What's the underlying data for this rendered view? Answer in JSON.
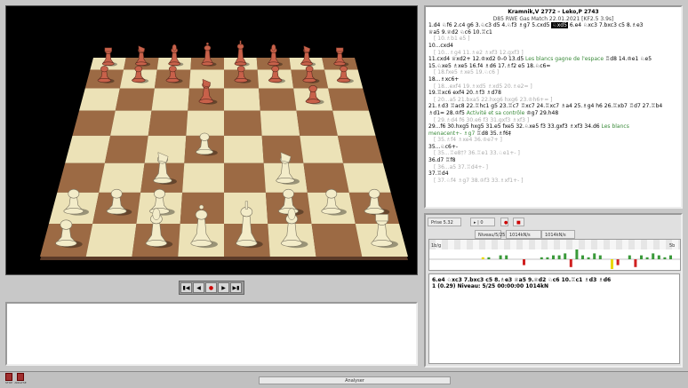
{
  "board": {
    "files": 8,
    "ranks": 8
  },
  "nav": {
    "buttons": [
      {
        "name": "first-move",
        "glyph": "▮◀"
      },
      {
        "name": "prev-move",
        "glyph": "◀"
      },
      {
        "name": "play",
        "glyph": "●"
      },
      {
        "name": "next-move",
        "glyph": "▶"
      },
      {
        "name": "last-move",
        "glyph": "▶▮"
      }
    ]
  },
  "notation": {
    "header": "Kramnik,V 2772 – Leko,P 2743",
    "subheader": "D85 RWE Gas Match 22.01.2021 [KF2.5 3.9s]",
    "lines": [
      {
        "t": "1.d4 ♘f6 2.c4 g6 3.♘c3 d5 4.♘f3 ♗g7 5.cxd5 ",
        "cur": "♘xd5",
        "after": " 6.e4 ♘xc3 7.bxc3 c5 8.♗e3"
      },
      {
        "t": "♕a5 9.♕d2 ♘c6 10.♖c1"
      },
      {
        "t": "[ 10.♗b1 e5 ]",
        "v": true
      },
      {
        "t": "10...cxd4"
      },
      {
        "t": "[ 10...♗g4 11.♗e2 ♗xf3 12.gxf3 ]",
        "v": true
      },
      {
        "t": "11.cxd4 ♕xd2+ 12.♔xd2 0–0 13.d5 ",
        "g": "Les blancs gagne de l'espace",
        "after": " ♖d8 14.♔e1 ♘e5"
      },
      {
        "t": "15.♘xe5 ♗xe5 16.f4 ♗d6 17.♗f2 e5 18.♘c6="
      },
      {
        "t": "[ 18.fxe5 ♗xe5 19.♘c6 ]",
        "v": true
      },
      {
        "t": "18...♗xc6+"
      },
      {
        "t": "[ 18...exf4 19.♗xd5 ♗xd5 20.♗e2= ]",
        "v": true
      },
      {
        "t": "19.♖xc6 exf4 20.♗f3 ♗d78"
      },
      {
        "t": "[ 20...a5 21.bxa5 22.hxg6 hxg6 23.♔h6+= ]",
        "v": true
      },
      {
        "t": "21.♗d3 ♖ac8 22.♖hc1 g5 23.♖c7 ♖xc7 24.♖xc7 ♗a4 25.♗g4 h6 26.♖xb7 ♖d7 27.♖b4"
      },
      {
        "t": "♗d1= 28.♔f5 ",
        "g": "Activité et sa contrôle",
        "after": " ♔g7 29.h48"
      },
      {
        "t": "[ 29.♗d4 f6 30.e6 f3 31.gxf3 ♗xf3 ]",
        "v": true
      },
      {
        "t": "29...f6 30.hxg5 hxg5 31.e5 fxe5 32.♘xe5 f3 33.gxf3 ♗xf3 34.d6 ",
        "g": "Les blancs"
      },
      {
        "t": "",
        "g": "menacent+- ♗g7",
        "after": " ♖d8 35.♗f6‡"
      },
      {
        "t": "[ 35.♗f4 ♗xe4 36.♔e7+ ]",
        "v": true
      },
      {
        "t": "35...♘c6+-"
      },
      {
        "t": "[ 35...♖e8†? 36.♖e1 33.♘e1+- ]",
        "v": true
      },
      {
        "t": "36.d7 ♖f8"
      },
      {
        "t": "[ 36...a5 37.♖d4+- ]",
        "v": true
      },
      {
        "t": "37.♖d4"
      },
      {
        "t": "[ 37.♘f4 ♗g7 38.♔f3 33.♗xf1+- ]",
        "v": true
      }
    ]
  },
  "analysis": {
    "toolbar": {
      "time": "Prise 5.32",
      "mode": "▸ | 0",
      "depth": "Niveau/5/25",
      "nps": "1014kN/s"
    },
    "graph_label_left": "1b/g",
    "graph_label_right": "5b",
    "graph_bars": [
      0,
      0,
      0,
      0,
      0,
      0,
      0,
      0,
      1,
      1,
      0,
      2,
      2,
      0,
      0,
      -3,
      0,
      0,
      1,
      1,
      2,
      2,
      3,
      -4,
      5,
      2,
      1,
      3,
      2,
      0,
      -5,
      -3,
      0,
      2,
      -4,
      2,
      1,
      3,
      2,
      1,
      2
    ],
    "line1": "6.e4 ♘xc3 7.bxc3 c5 8.♗e3 ♕a5 9.♕d2 ♘c6 10.♖c1 ♗d3 ♗d6",
    "line2": "1   (0.29)   Niveau: 5/25    00:00:00    1014kN"
  },
  "status": {
    "text": "Analyser",
    "btn1": "STOP",
    "btn2": "ANALYSE"
  },
  "colors": {
    "light": "#ece2b7",
    "dark": "#9c6a44",
    "white_piece": "#f3ecc9",
    "black_piece": "#c8614a"
  }
}
